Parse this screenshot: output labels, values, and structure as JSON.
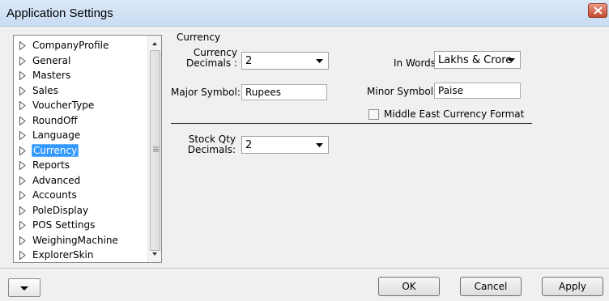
{
  "window": {
    "title": "Application Settings"
  },
  "tree": {
    "items": [
      {
        "label": "CompanyProfile"
      },
      {
        "label": "General"
      },
      {
        "label": "Masters"
      },
      {
        "label": "Sales"
      },
      {
        "label": "VoucherType"
      },
      {
        "label": "RoundOff"
      },
      {
        "label": "Language"
      },
      {
        "label": "Currency",
        "selected": true
      },
      {
        "label": "Reports"
      },
      {
        "label": "Advanced"
      },
      {
        "label": "Accounts"
      },
      {
        "label": "PoleDisplay"
      },
      {
        "label": "POS Settings"
      },
      {
        "label": "WeighingMachine"
      },
      {
        "label": "ExplorerSkin"
      }
    ]
  },
  "currency": {
    "section_title": "Currency",
    "decimals_label_line1": "Currency",
    "decimals_label_line2": "Decimals :",
    "decimals_value": "2",
    "in_words_label": "In Words:",
    "in_words_value": "Lakhs & Crore",
    "major_symbol_label": "Major Symbol:",
    "major_symbol_value": "Rupees",
    "minor_symbol_label": "Minor Symbol:",
    "minor_symbol_value": "Paise",
    "middle_east_label": "Middle East Currency Format",
    "middle_east_checked": false,
    "stock_qty_label_line1": "Stock Qty",
    "stock_qty_label_line2": "Decimals:",
    "stock_qty_value": "2"
  },
  "buttons": {
    "ok": "OK",
    "cancel": "Cancel",
    "apply": "Apply"
  }
}
